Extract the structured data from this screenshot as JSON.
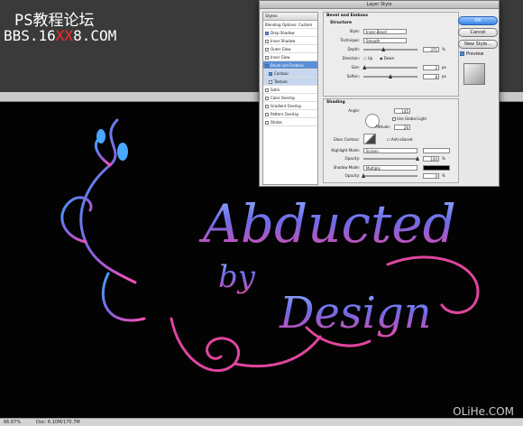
{
  "watermark": {
    "line1": "PS教程论坛",
    "line2_prefix": "BBS.16",
    "line2_red": "XX",
    "line2_suffix": "8.COM",
    "corner": "OLiHe.COM"
  },
  "document": {
    "zoom": "66.67%",
    "doc_info": "Doc: 6.10M/170.7M",
    "artwork_words": [
      "Abducted",
      "by",
      "Design"
    ]
  },
  "dialog": {
    "title": "Layer Style",
    "styles_header": "Styles",
    "styles": [
      {
        "label": "Blending Options: Custom",
        "checked": false,
        "kind": "plain"
      },
      {
        "label": "Drop Shadow",
        "checked": true,
        "kind": "plain"
      },
      {
        "label": "Inner Shadow",
        "checked": false,
        "kind": "plain"
      },
      {
        "label": "Outer Glow",
        "checked": false,
        "kind": "plain"
      },
      {
        "label": "Inner Glow",
        "checked": false,
        "kind": "plain"
      },
      {
        "label": "Bevel and Emboss",
        "checked": true,
        "kind": "selected"
      },
      {
        "label": "Contour",
        "checked": true,
        "kind": "sub"
      },
      {
        "label": "Texture",
        "checked": false,
        "kind": "sub"
      },
      {
        "label": "Satin",
        "checked": false,
        "kind": "plain"
      },
      {
        "label": "Color Overlay",
        "checked": false,
        "kind": "plain"
      },
      {
        "label": "Gradient Overlay",
        "checked": false,
        "kind": "plain"
      },
      {
        "label": "Pattern Overlay",
        "checked": false,
        "kind": "plain"
      },
      {
        "label": "Stroke",
        "checked": false,
        "kind": "plain"
      }
    ],
    "bevel": {
      "section": "Bevel and Emboss",
      "structure": "Structure",
      "style_label": "Style:",
      "style_value": "Inner Bevel",
      "technique_label": "Technique:",
      "technique_value": "Smooth",
      "depth_label": "Depth:",
      "depth_value": "371",
      "depth_level": 0.37,
      "percent": "%",
      "direction_label": "Direction:",
      "dir_up": "Up",
      "dir_down": "Down",
      "size_label": "Size:",
      "size_value": "2",
      "size_level": 0.02,
      "px": "px",
      "soften_label": "Soften:",
      "soften_value": "8",
      "soften_level": 0.5
    },
    "shading": {
      "title": "Shading",
      "angle_label": "Angle:",
      "angle_value": "145",
      "global_light": "Use Global Light",
      "altitude_label": "Altitude:",
      "altitude_value": "26",
      "gloss_label": "Gloss Contour:",
      "anti_aliased": "Anti-aliased",
      "highlight_label": "Highlight Mode:",
      "highlight_value": "Screen",
      "opacity_label": "Opacity:",
      "hl_opacity": "100",
      "hl_level": 1.0,
      "shadow_label": "Shadow Mode:",
      "shadow_value": "Multiply",
      "sh_opacity": "0",
      "sh_level": 0.0
    },
    "buttons": {
      "ok": "OK",
      "cancel": "Cancel",
      "new_style": "New Style...",
      "preview": "Preview"
    }
  }
}
